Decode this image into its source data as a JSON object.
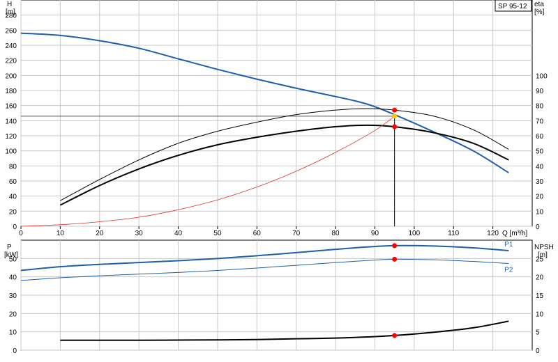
{
  "model_label": "SP 95-12",
  "colors": {
    "head": "#1f5fa8",
    "flow_power": "#1f5fa8",
    "eff": "#000000",
    "system": "#e03030",
    "marker": "#ff0000",
    "marker_ring": "#f5d000",
    "grid": "#c8c8c8",
    "axis": "#000000",
    "duty": "#000000"
  },
  "chart_data": [
    {
      "type": "line",
      "title": "",
      "xlabel": "Q [m³/h]",
      "xlim": [
        0,
        130
      ],
      "xticks": [
        0,
        10,
        20,
        30,
        40,
        50,
        60,
        70,
        80,
        90,
        100,
        110,
        120
      ],
      "left_axis": {
        "label": "H",
        "unit": "[m]",
        "ylim": [
          0,
          300
        ],
        "ticks": [
          0,
          20,
          40,
          60,
          80,
          100,
          120,
          140,
          160,
          180,
          200,
          220,
          240,
          260,
          280
        ]
      },
      "right_axis": {
        "label": "eta",
        "unit": "[%]",
        "ylim": [
          0,
          150
        ],
        "ticks": [
          0,
          10,
          20,
          30,
          40,
          50,
          60,
          70,
          80,
          90,
          100
        ]
      },
      "series": [
        {
          "key": "head",
          "axis": "left",
          "x": [
            0,
            10,
            20,
            30,
            40,
            50,
            60,
            70,
            80,
            88,
            95,
            105,
            115,
            124
          ],
          "y": [
            256,
            253,
            246,
            236,
            222,
            208,
            195,
            183,
            172,
            162,
            148,
            125,
            100,
            71
          ]
        },
        {
          "key": "eta_thin",
          "axis": "right",
          "x": [
            10,
            20,
            30,
            40,
            50,
            60,
            70,
            80,
            88,
            95,
            105,
            115,
            124
          ],
          "y": [
            17,
            31,
            44,
            55,
            63,
            69,
            74,
            77,
            78,
            77,
            73,
            64,
            51
          ]
        },
        {
          "key": "eta_thick",
          "axis": "right",
          "x": [
            10,
            20,
            30,
            40,
            50,
            60,
            70,
            80,
            88,
            95,
            105,
            115,
            124
          ],
          "y": [
            14,
            27,
            38,
            47,
            54,
            59,
            63,
            66,
            67,
            66,
            62,
            55,
            44
          ]
        },
        {
          "key": "system",
          "axis": "left",
          "x": [
            0,
            10,
            20,
            30,
            40,
            50,
            60,
            70,
            80,
            90,
            95
          ],
          "y": [
            0,
            2,
            6,
            12,
            22,
            35,
            52,
            73,
            98,
            127,
            146
          ]
        }
      ],
      "duty_point": {
        "q": 95,
        "h": 146
      },
      "markers": [
        {
          "axis": "left",
          "x": 95,
          "y": 154
        },
        {
          "axis": "left",
          "x": 95,
          "y": 146
        },
        {
          "axis": "right",
          "x": 95,
          "y": 66
        }
      ]
    },
    {
      "type": "line",
      "title": "",
      "left_axis": {
        "label": "P",
        "unit": "[kW]",
        "ylim": [
          0,
          60
        ],
        "ticks": [
          0,
          10,
          20,
          30,
          40,
          50
        ]
      },
      "right_axis": {
        "label": "NPSH",
        "unit": "[m]",
        "ylim": [
          0,
          30
        ],
        "ticks": [
          0,
          5,
          10,
          15,
          20,
          25
        ]
      },
      "xlim": [
        0,
        130
      ],
      "series": [
        {
          "key": "P1",
          "name": "P1",
          "axis": "left",
          "x": [
            0,
            10,
            20,
            30,
            40,
            50,
            60,
            70,
            80,
            88,
            95,
            105,
            115,
            124
          ],
          "y": [
            43.5,
            45.5,
            46.8,
            47.8,
            48.8,
            50,
            51.5,
            53.2,
            55,
            56.3,
            57,
            56.8,
            55.8,
            54.3
          ]
        },
        {
          "key": "P2",
          "name": "P2",
          "axis": "left",
          "x": [
            0,
            10,
            20,
            30,
            40,
            50,
            60,
            70,
            80,
            88,
            95,
            105,
            115,
            124
          ],
          "y": [
            38,
            39.5,
            40.6,
            41.5,
            42.4,
            43.5,
            44.8,
            46.3,
            47.8,
            48.9,
            49.6,
            49.3,
            48.4,
            47.3
          ]
        },
        {
          "key": "npsh",
          "axis": "right",
          "x": [
            10,
            20,
            30,
            40,
            50,
            60,
            70,
            80,
            88,
            95,
            105,
            115,
            124
          ],
          "y": [
            2.7,
            2.7,
            2.7,
            2.75,
            2.8,
            2.9,
            3.1,
            3.3,
            3.6,
            4,
            4.9,
            6.1,
            7.9
          ]
        }
      ],
      "markers": [
        {
          "axis": "left",
          "x": 95,
          "y": 57
        },
        {
          "axis": "left",
          "x": 95,
          "y": 49.6
        },
        {
          "axis": "right",
          "x": 95,
          "y": 4
        }
      ]
    }
  ]
}
